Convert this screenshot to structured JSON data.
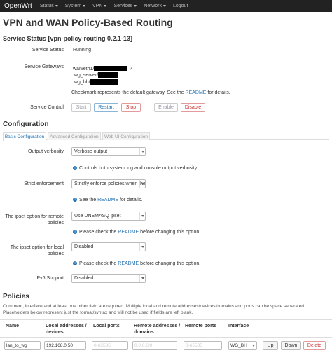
{
  "nav": {
    "brand": "OpenWrt",
    "items": [
      "Status",
      "System",
      "VPN",
      "Services",
      "Network",
      "Logout"
    ]
  },
  "page": {
    "title": "VPN and WAN Policy-Based Routing",
    "status_heading": "Service Status [vpn-policy-routing 0.2.1-13]"
  },
  "status": {
    "service_status_label": "Service Status",
    "service_status_value": "Running",
    "gateways_label": "Service Gateways",
    "gateways": [
      "wan/eth1/",
      "wg_server/",
      "wg_bh/"
    ],
    "gateway_note_pre": "Checkmark represents the default gateway. See the ",
    "gateway_note_link": "README",
    "gateway_note_post": " for details.",
    "control_label": "Service Control",
    "buttons": {
      "start": "Start",
      "restart": "Restart",
      "stop": "Stop",
      "enable": "Enable",
      "disable": "Disable"
    }
  },
  "config": {
    "heading": "Configuration",
    "tabs": [
      "Basic Configuration",
      "Advanced Configuration",
      "Web UI Configuration"
    ],
    "verbosity_label": "Output verbosity",
    "verbosity_value": "Verbose output",
    "verbosity_help": "Controls both system log and console output verbosity.",
    "strict_label": "Strict enforcement",
    "strict_value": "Strictly enforce policies when the",
    "strict_help_pre": "See the ",
    "strict_help_link": "README",
    "strict_help_post": " for details.",
    "ipset_remote_label_1": "The ipset option for remote",
    "ipset_remote_label_2": "policies",
    "ipset_remote_value": "Use DNSMASQ ipset",
    "ipset_remote_help_pre": "Please check the ",
    "ipset_remote_help_link": "README",
    "ipset_remote_help_post": " before changing this option.",
    "ipset_local_label_1": "The ipset option for local",
    "ipset_local_label_2": "policies",
    "ipset_local_value": "Disabled",
    "ipset_local_help_pre": "Please check the ",
    "ipset_local_help_link": "README",
    "ipset_local_help_post": " before changing this option.",
    "ipv6_label": "IPv6 Support",
    "ipv6_value": "Disabled"
  },
  "policies": {
    "heading": "Policies",
    "note_1": "Comment, interface and at least one other field are required. Multiple local and remote addresses/devices/domains and ports can be space separated.",
    "note_2": "Placeholders below represent just the format/syntax and will not be used if fields are left blank.",
    "columns": {
      "name": "Name",
      "local_addr_1": "Local addresses /",
      "local_addr_2": "devices",
      "local_ports": "Local ports",
      "remote_addr_1": "Remote addresses /",
      "remote_addr_2": "domains",
      "remote_ports": "Remote ports",
      "interface": "Interface"
    },
    "row": {
      "name": "lan_to_wg",
      "local_addr": "192.168.0.50",
      "local_ports_ph": "0-65535",
      "remote_addr_ph": "0.0.0.0/0",
      "remote_ports_ph": "0-65535",
      "interface": "WG_BH",
      "up": "Up",
      "down": "Down",
      "delete": "Delete"
    }
  }
}
